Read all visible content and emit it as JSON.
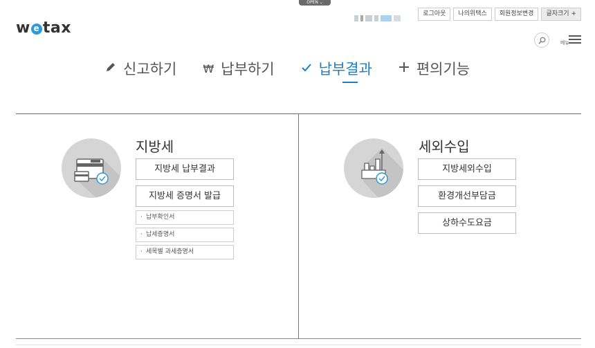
{
  "top": {
    "open_label": "OPEN",
    "logo_pre": "w",
    "logo_e": "e",
    "logo_post": "tax",
    "util_buttons": [
      "로그아웃",
      "나의위택스",
      "회원정보변경",
      "글자크기 +"
    ],
    "menu_label": "메뉴"
  },
  "nav": {
    "items": [
      {
        "label": "신고하기",
        "icon": "pencil-icon",
        "active": false
      },
      {
        "label": "납부하기",
        "icon": "won-icon",
        "active": false
      },
      {
        "label": "납부결과",
        "icon": "check-icon",
        "active": true
      },
      {
        "label": "편의기능",
        "icon": "plus-icon",
        "active": false
      }
    ]
  },
  "local_tax": {
    "title": "지방세",
    "buttons": [
      "지방세 납부결과",
      "지방세 증명서 발급"
    ],
    "sub_links": [
      "납부확인서",
      "납세증명서",
      "세목별 과세증명서"
    ]
  },
  "non_tax": {
    "title": "세외수입",
    "buttons": [
      "지방세외수입",
      "환경개선부담금",
      "상하수도요금"
    ]
  },
  "colors": {
    "accent": "#1d7fc1",
    "circle_bg": "#d5d5d5",
    "logo_e": "#2e9ad8"
  }
}
